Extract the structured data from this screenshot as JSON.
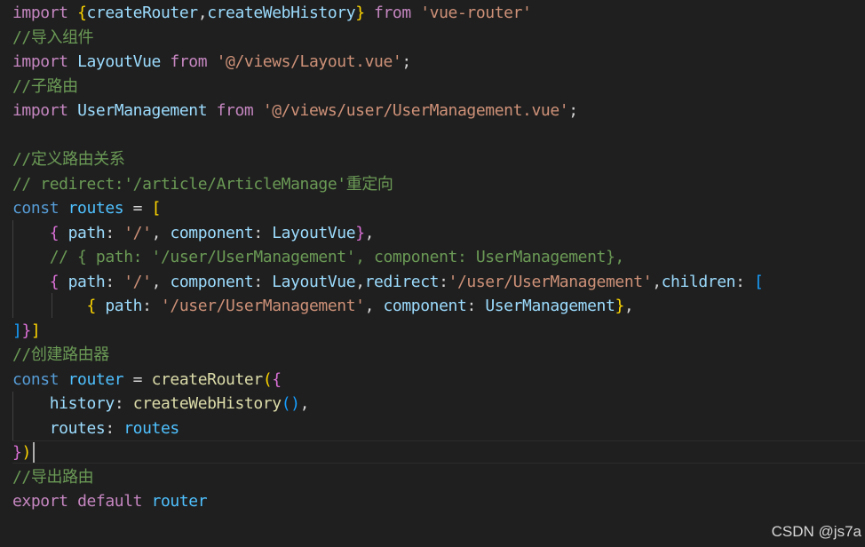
{
  "colors": {
    "background": "#1f1f1f",
    "keyword_import": "#c586c0",
    "keyword_decl": "#569cd6",
    "identifier": "#9cdcfe",
    "function": "#dcdcaa",
    "string": "#ce9178",
    "comment": "#6a9955",
    "text": "#d4d4d4",
    "bracket_gold": "#ffd700",
    "bracket_pink": "#da70d6",
    "bracket_blue": "#179fff",
    "type": "#4ec9b0"
  },
  "code_lines": [
    [
      [
        "import ",
        "#c586c0"
      ],
      [
        "{",
        "#ffd700"
      ],
      [
        "createRouter",
        "#9cdcfe"
      ],
      [
        ",",
        "#d4d4d4"
      ],
      [
        "createWebHistory",
        "#9cdcfe"
      ],
      [
        "}",
        "#ffd700"
      ],
      [
        " from ",
        "#c586c0"
      ],
      [
        "'vue-router'",
        "#ce9178"
      ]
    ],
    [
      [
        "//导入组件",
        "#6a9955"
      ]
    ],
    [
      [
        "import ",
        "#c586c0"
      ],
      [
        "LayoutVue",
        "#9cdcfe"
      ],
      [
        " from ",
        "#c586c0"
      ],
      [
        "'@/views/Layout.vue'",
        "#ce9178"
      ],
      [
        ";",
        "#d4d4d4"
      ]
    ],
    [
      [
        "//子路由",
        "#6a9955"
      ]
    ],
    [
      [
        "import ",
        "#c586c0"
      ],
      [
        "UserManagement",
        "#9cdcfe"
      ],
      [
        " from ",
        "#c586c0"
      ],
      [
        "'@/views/user/UserManagement.vue'",
        "#ce9178"
      ],
      [
        ";",
        "#d4d4d4"
      ]
    ],
    [],
    [
      [
        "//定义路由关系",
        "#6a9955"
      ]
    ],
    [
      [
        "// redirect:'/article/ArticleManage'重定向",
        "#6a9955"
      ]
    ],
    [
      [
        "const ",
        "#569cd6"
      ],
      [
        "routes",
        "#4fc1ff"
      ],
      [
        " = ",
        "#d4d4d4"
      ],
      [
        "[",
        "#ffd700"
      ]
    ],
    [
      [
        "    ",
        "#d4d4d4"
      ],
      [
        "{",
        "#da70d6"
      ],
      [
        " path",
        "#9cdcfe"
      ],
      [
        ": ",
        "#d4d4d4"
      ],
      [
        "'/'",
        "#ce9178"
      ],
      [
        ", ",
        "#d4d4d4"
      ],
      [
        "component",
        "#9cdcfe"
      ],
      [
        ": ",
        "#d4d4d4"
      ],
      [
        "LayoutVue",
        "#9cdcfe"
      ],
      [
        "}",
        "#da70d6"
      ],
      [
        ",",
        "#d4d4d4"
      ]
    ],
    [
      [
        "    ",
        "#d4d4d4"
      ],
      [
        "// { path: '/user/UserManagement', component: UserManagement},",
        "#6a9955"
      ]
    ],
    [
      [
        "    ",
        "#d4d4d4"
      ],
      [
        "{",
        "#da70d6"
      ],
      [
        " path",
        "#9cdcfe"
      ],
      [
        ": ",
        "#d4d4d4"
      ],
      [
        "'/'",
        "#ce9178"
      ],
      [
        ", ",
        "#d4d4d4"
      ],
      [
        "component",
        "#9cdcfe"
      ],
      [
        ": ",
        "#d4d4d4"
      ],
      [
        "LayoutVue",
        "#9cdcfe"
      ],
      [
        ",",
        "#d4d4d4"
      ],
      [
        "redirect",
        "#9cdcfe"
      ],
      [
        ":",
        "#d4d4d4"
      ],
      [
        "'/user/UserManagement'",
        "#ce9178"
      ],
      [
        ",",
        "#d4d4d4"
      ],
      [
        "children",
        "#9cdcfe"
      ],
      [
        ": ",
        "#d4d4d4"
      ],
      [
        "[",
        "#179fff"
      ]
    ],
    [
      [
        "        ",
        "#d4d4d4"
      ],
      [
        "{",
        "#ffd700"
      ],
      [
        " path",
        "#9cdcfe"
      ],
      [
        ": ",
        "#d4d4d4"
      ],
      [
        "'/user/UserManagement'",
        "#ce9178"
      ],
      [
        ", ",
        "#d4d4d4"
      ],
      [
        "component",
        "#9cdcfe"
      ],
      [
        ": ",
        "#d4d4d4"
      ],
      [
        "UserManagement",
        "#9cdcfe"
      ],
      [
        "}",
        "#ffd700"
      ],
      [
        ",",
        "#d4d4d4"
      ]
    ],
    [
      [
        "]",
        "#179fff"
      ],
      [
        "}",
        "#da70d6"
      ],
      [
        "]",
        "#ffd700"
      ]
    ],
    [
      [
        "//创建路由器",
        "#6a9955"
      ]
    ],
    [
      [
        "const ",
        "#569cd6"
      ],
      [
        "router",
        "#4fc1ff"
      ],
      [
        " = ",
        "#d4d4d4"
      ],
      [
        "createRouter",
        "#dcdcaa"
      ],
      [
        "(",
        "#ffd700"
      ],
      [
        "{",
        "#da70d6"
      ]
    ],
    [
      [
        "    ",
        "#d4d4d4"
      ],
      [
        "history",
        "#9cdcfe"
      ],
      [
        ": ",
        "#d4d4d4"
      ],
      [
        "createWebHistory",
        "#dcdcaa"
      ],
      [
        "()",
        "#179fff"
      ],
      [
        ",",
        "#d4d4d4"
      ]
    ],
    [
      [
        "    ",
        "#d4d4d4"
      ],
      [
        "routes",
        "#9cdcfe"
      ],
      [
        ": ",
        "#d4d4d4"
      ],
      [
        "routes",
        "#4fc1ff"
      ]
    ],
    [
      [
        "}",
        "#da70d6"
      ],
      [
        ")",
        "#ffd700"
      ]
    ],
    [
      [
        "//导出路由",
        "#6a9955"
      ]
    ],
    [
      [
        "export ",
        "#c586c0"
      ],
      [
        "default ",
        "#c586c0"
      ],
      [
        "router",
        "#4fc1ff"
      ]
    ]
  ],
  "watermark": "CSDN @js7a"
}
